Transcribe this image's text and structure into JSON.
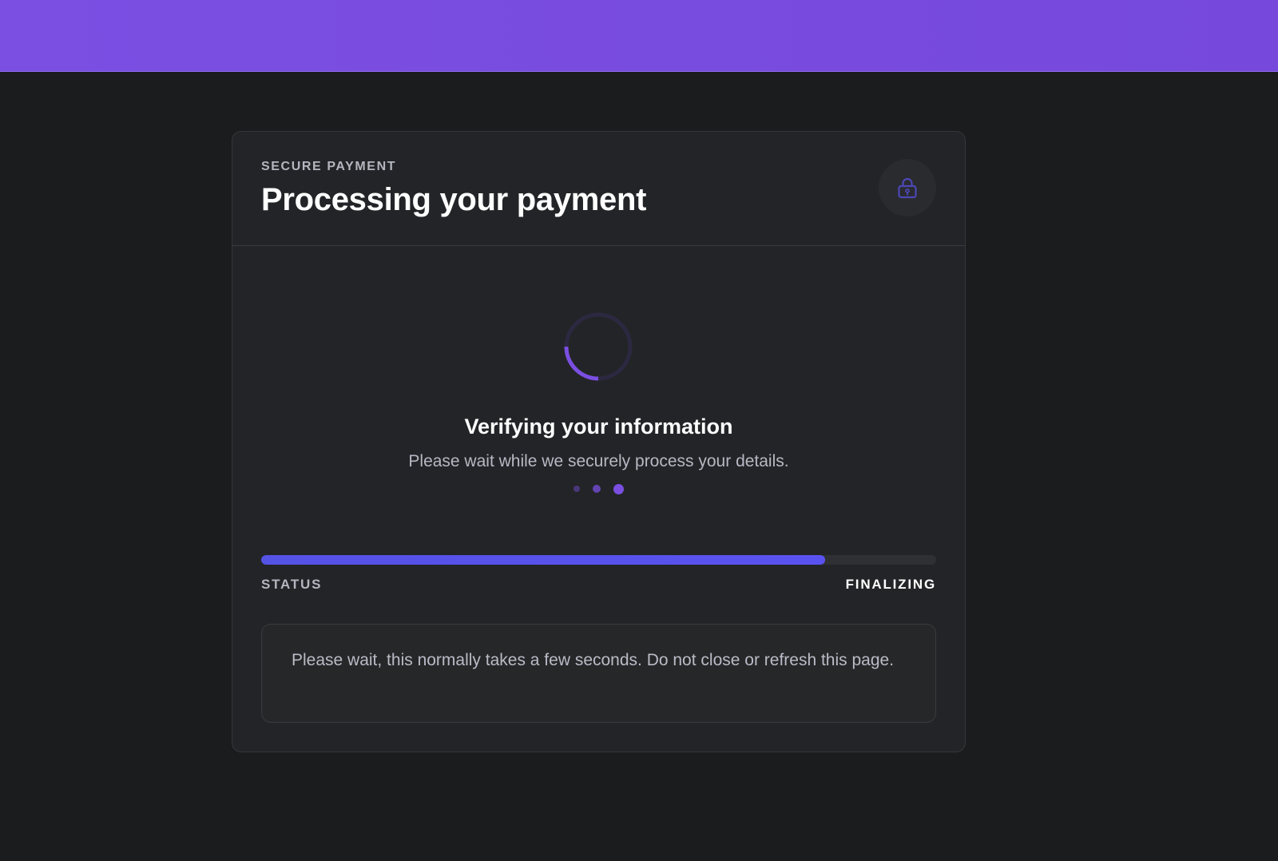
{
  "header": {
    "eyebrow": "SECURE PAYMENT",
    "title": "Processing your payment",
    "lock_icon": "lock-icon"
  },
  "loading": {
    "title": "Verifying your information",
    "subtitle": "Please wait while we securely process your details."
  },
  "progress": {
    "value_percent": 83.5,
    "label": "STATUS",
    "value": "FINALIZING"
  },
  "notice": {
    "text": "Please wait, this normally takes a few seconds. Do not close or refresh this page."
  },
  "colors": {
    "accent": "#7a4fe0",
    "progress": "#5552e6",
    "background": "#1b1c1e",
    "card": "#232427"
  }
}
